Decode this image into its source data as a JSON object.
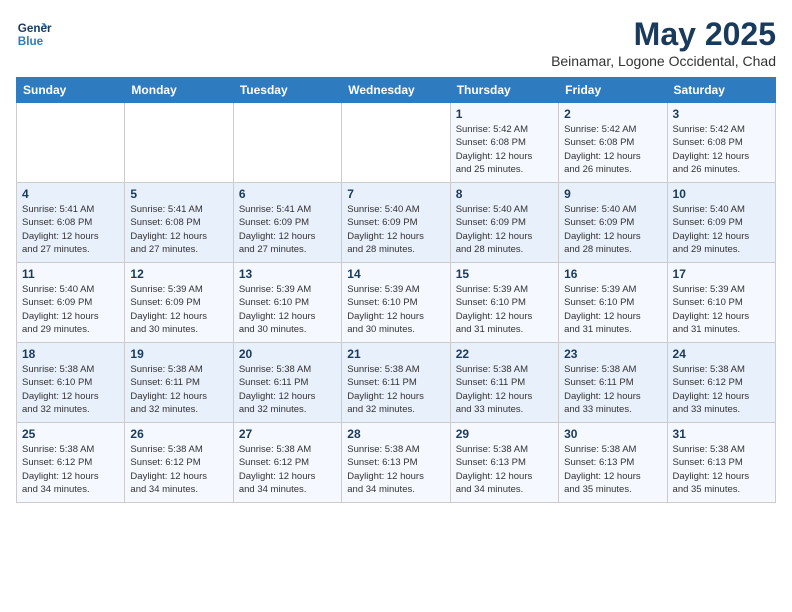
{
  "logo": {
    "line1": "General",
    "line2": "Blue"
  },
  "header": {
    "month": "May 2025",
    "location": "Beinamar, Logone Occidental, Chad"
  },
  "weekdays": [
    "Sunday",
    "Monday",
    "Tuesday",
    "Wednesday",
    "Thursday",
    "Friday",
    "Saturday"
  ],
  "weeks": [
    [
      {
        "day": "",
        "info": ""
      },
      {
        "day": "",
        "info": ""
      },
      {
        "day": "",
        "info": ""
      },
      {
        "day": "",
        "info": ""
      },
      {
        "day": "1",
        "info": "Sunrise: 5:42 AM\nSunset: 6:08 PM\nDaylight: 12 hours\nand 25 minutes."
      },
      {
        "day": "2",
        "info": "Sunrise: 5:42 AM\nSunset: 6:08 PM\nDaylight: 12 hours\nand 26 minutes."
      },
      {
        "day": "3",
        "info": "Sunrise: 5:42 AM\nSunset: 6:08 PM\nDaylight: 12 hours\nand 26 minutes."
      }
    ],
    [
      {
        "day": "4",
        "info": "Sunrise: 5:41 AM\nSunset: 6:08 PM\nDaylight: 12 hours\nand 27 minutes."
      },
      {
        "day": "5",
        "info": "Sunrise: 5:41 AM\nSunset: 6:08 PM\nDaylight: 12 hours\nand 27 minutes."
      },
      {
        "day": "6",
        "info": "Sunrise: 5:41 AM\nSunset: 6:09 PM\nDaylight: 12 hours\nand 27 minutes."
      },
      {
        "day": "7",
        "info": "Sunrise: 5:40 AM\nSunset: 6:09 PM\nDaylight: 12 hours\nand 28 minutes."
      },
      {
        "day": "8",
        "info": "Sunrise: 5:40 AM\nSunset: 6:09 PM\nDaylight: 12 hours\nand 28 minutes."
      },
      {
        "day": "9",
        "info": "Sunrise: 5:40 AM\nSunset: 6:09 PM\nDaylight: 12 hours\nand 28 minutes."
      },
      {
        "day": "10",
        "info": "Sunrise: 5:40 AM\nSunset: 6:09 PM\nDaylight: 12 hours\nand 29 minutes."
      }
    ],
    [
      {
        "day": "11",
        "info": "Sunrise: 5:40 AM\nSunset: 6:09 PM\nDaylight: 12 hours\nand 29 minutes."
      },
      {
        "day": "12",
        "info": "Sunrise: 5:39 AM\nSunset: 6:09 PM\nDaylight: 12 hours\nand 30 minutes."
      },
      {
        "day": "13",
        "info": "Sunrise: 5:39 AM\nSunset: 6:10 PM\nDaylight: 12 hours\nand 30 minutes."
      },
      {
        "day": "14",
        "info": "Sunrise: 5:39 AM\nSunset: 6:10 PM\nDaylight: 12 hours\nand 30 minutes."
      },
      {
        "day": "15",
        "info": "Sunrise: 5:39 AM\nSunset: 6:10 PM\nDaylight: 12 hours\nand 31 minutes."
      },
      {
        "day": "16",
        "info": "Sunrise: 5:39 AM\nSunset: 6:10 PM\nDaylight: 12 hours\nand 31 minutes."
      },
      {
        "day": "17",
        "info": "Sunrise: 5:39 AM\nSunset: 6:10 PM\nDaylight: 12 hours\nand 31 minutes."
      }
    ],
    [
      {
        "day": "18",
        "info": "Sunrise: 5:38 AM\nSunset: 6:10 PM\nDaylight: 12 hours\nand 32 minutes."
      },
      {
        "day": "19",
        "info": "Sunrise: 5:38 AM\nSunset: 6:11 PM\nDaylight: 12 hours\nand 32 minutes."
      },
      {
        "day": "20",
        "info": "Sunrise: 5:38 AM\nSunset: 6:11 PM\nDaylight: 12 hours\nand 32 minutes."
      },
      {
        "day": "21",
        "info": "Sunrise: 5:38 AM\nSunset: 6:11 PM\nDaylight: 12 hours\nand 32 minutes."
      },
      {
        "day": "22",
        "info": "Sunrise: 5:38 AM\nSunset: 6:11 PM\nDaylight: 12 hours\nand 33 minutes."
      },
      {
        "day": "23",
        "info": "Sunrise: 5:38 AM\nSunset: 6:11 PM\nDaylight: 12 hours\nand 33 minutes."
      },
      {
        "day": "24",
        "info": "Sunrise: 5:38 AM\nSunset: 6:12 PM\nDaylight: 12 hours\nand 33 minutes."
      }
    ],
    [
      {
        "day": "25",
        "info": "Sunrise: 5:38 AM\nSunset: 6:12 PM\nDaylight: 12 hours\nand 34 minutes."
      },
      {
        "day": "26",
        "info": "Sunrise: 5:38 AM\nSunset: 6:12 PM\nDaylight: 12 hours\nand 34 minutes."
      },
      {
        "day": "27",
        "info": "Sunrise: 5:38 AM\nSunset: 6:12 PM\nDaylight: 12 hours\nand 34 minutes."
      },
      {
        "day": "28",
        "info": "Sunrise: 5:38 AM\nSunset: 6:13 PM\nDaylight: 12 hours\nand 34 minutes."
      },
      {
        "day": "29",
        "info": "Sunrise: 5:38 AM\nSunset: 6:13 PM\nDaylight: 12 hours\nand 34 minutes."
      },
      {
        "day": "30",
        "info": "Sunrise: 5:38 AM\nSunset: 6:13 PM\nDaylight: 12 hours\nand 35 minutes."
      },
      {
        "day": "31",
        "info": "Sunrise: 5:38 AM\nSunset: 6:13 PM\nDaylight: 12 hours\nand 35 minutes."
      }
    ]
  ]
}
